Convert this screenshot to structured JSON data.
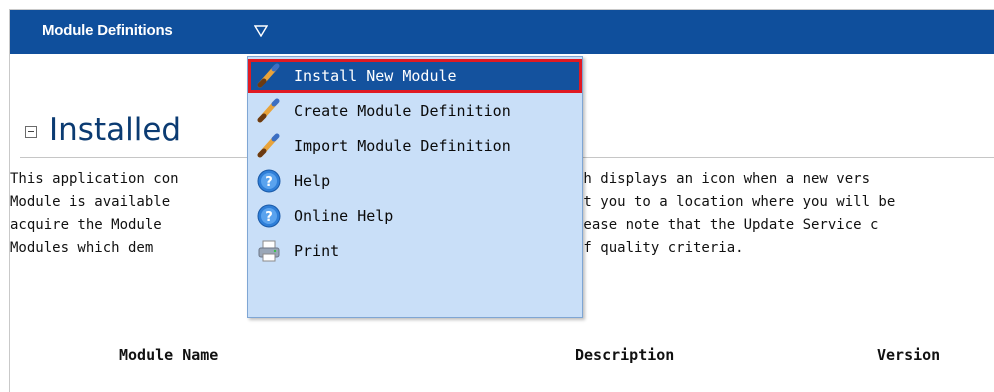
{
  "header": {
    "title": "Module Definitions",
    "caret_icon": "triangle-down-outline-icon",
    "bg_color": "#0f4f9c"
  },
  "section": {
    "heading": "Installed",
    "collapse_icon": "minus-box-icon",
    "description_lines": [
      "This application con",
      "Module is available",
      "acquire the Module",
      "Modules which dem",
      "ch displays an icon when a new vers",
      "ct you to a location where you will be",
      "lease note that the Update Service c",
      "of quality criteria."
    ]
  },
  "table": {
    "columns": [
      "Module Name",
      "Description",
      "Version"
    ]
  },
  "menu": {
    "items": [
      {
        "label": "Install New Module",
        "icon": "pencil-icon",
        "selected": true
      },
      {
        "label": "Create Module Definition",
        "icon": "pencil-icon"
      },
      {
        "label": "Import Module Definition",
        "icon": "pencil-icon"
      },
      {
        "label": "Help",
        "icon": "help-icon"
      },
      {
        "label": "Online Help",
        "icon": "help-icon"
      },
      {
        "label": "Print",
        "icon": "printer-icon"
      }
    ],
    "highlight_color": "#e01a22"
  }
}
